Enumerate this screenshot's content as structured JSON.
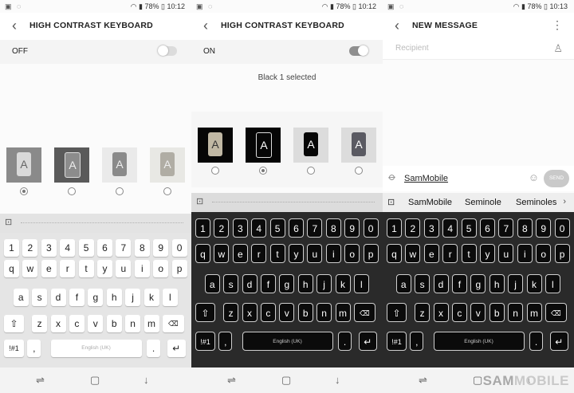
{
  "status": {
    "p1": {
      "battery": "78%",
      "time": "10:12"
    },
    "p2": {
      "battery": "78%",
      "time": "10:12"
    },
    "p3": {
      "battery": "78%",
      "time": "10:13"
    }
  },
  "panel1": {
    "title": "HIGH CONTRAST KEYBOARD",
    "toggle_label": "OFF",
    "themes": [
      "A",
      "A",
      "A",
      "A"
    ]
  },
  "panel2": {
    "title": "HIGH CONTRAST KEYBOARD",
    "toggle_label": "ON",
    "selection": "Black 1 selected",
    "themes": [
      "A",
      "A",
      "A",
      "A"
    ]
  },
  "panel3": {
    "title": "NEW MESSAGE",
    "recipient_placeholder": "Recipient",
    "message": "SamMobile",
    "send_label": "SEND",
    "suggestions": [
      "SamMobile",
      "Seminole",
      "Seminoles"
    ]
  },
  "keyboard": {
    "numbers": [
      "1",
      "2",
      "3",
      "4",
      "5",
      "6",
      "7",
      "8",
      "9",
      "0"
    ],
    "row1": [
      "q",
      "w",
      "e",
      "r",
      "t",
      "y",
      "u",
      "i",
      "o",
      "p"
    ],
    "row2": [
      "a",
      "s",
      "d",
      "f",
      "g",
      "h",
      "j",
      "k",
      "l"
    ],
    "row3": [
      "z",
      "x",
      "c",
      "v",
      "b",
      "n",
      "m"
    ],
    "symbols_label": "!#1",
    "comma": ",",
    "space_label": "English (UK)",
    "period": ".",
    "shift_icon": "⇧",
    "backspace_icon": "⌫",
    "enter_icon": "↵"
  },
  "watermark": {
    "left": "SAM",
    "right": "MOBILE"
  },
  "colors": {
    "light_keyboard_bg": "#e5e5e5",
    "dark_keyboard_bg": "#2a2a2a",
    "dark_key": "#0b0b0b"
  }
}
